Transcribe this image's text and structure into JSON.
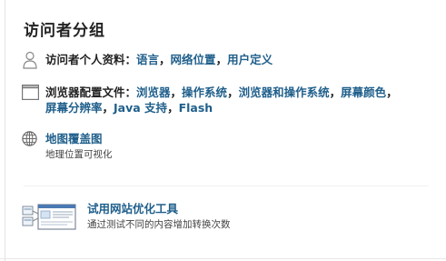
{
  "section": {
    "title": "访问者分组"
  },
  "profile": {
    "label": "访问者个人资料：",
    "links": [
      "语言",
      "网络位置",
      "用户定义"
    ],
    "separator": "，"
  },
  "browser": {
    "label": "浏览器配置文件：",
    "links_line1": [
      "浏览器",
      "操作系统",
      "浏览器和操作系统",
      "屏幕颜色"
    ],
    "links_line2": [
      "屏幕分辨率",
      "Java 支持",
      "Flash"
    ],
    "separator": "，"
  },
  "map_overlay": {
    "title": "地图覆盖图",
    "description": "地理位置可视化"
  },
  "optimizer": {
    "title": "试用网站优化工具",
    "description": "通过测试不同的内容增加转换次数"
  },
  "colors": {
    "link": "#1f5f8b",
    "text": "#222222"
  },
  "icons": {
    "profile": "person-icon",
    "browser": "browser-window-icon",
    "map": "globe-icon",
    "optimizer": "website-optimizer-icon"
  }
}
